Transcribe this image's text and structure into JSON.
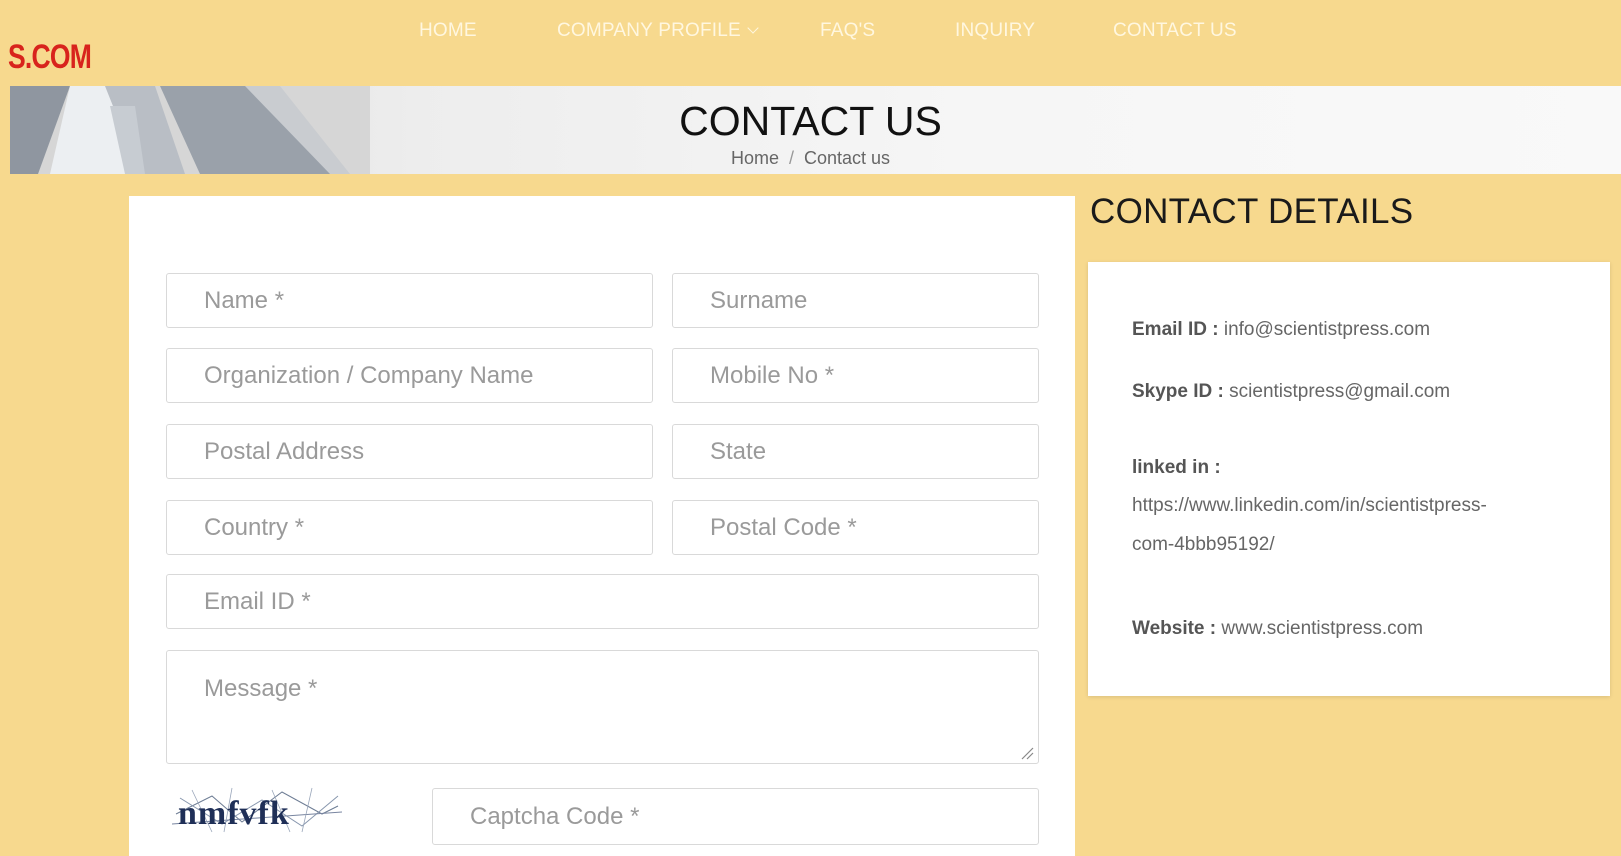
{
  "header": {
    "logo_fragment": "S.COM",
    "nav": {
      "home": "HOME",
      "company_profile": "COMPANY PROFILE",
      "faqs": "FAQ'S",
      "inquiry": "INQUIRY",
      "contact_us": "CONTACT US"
    }
  },
  "banner": {
    "title": "CONTACT US",
    "breadcrumb": {
      "home": "Home",
      "separator": "/",
      "current": "Contact us"
    }
  },
  "form": {
    "name": "Name *",
    "surname": "Surname",
    "organization": "Organization / Company Name",
    "mobile": "Mobile No *",
    "postal_address": "Postal Address",
    "state": "State",
    "country": "Country *",
    "postal_code": "Postal Code *",
    "email": "Email ID *",
    "message": "Message *",
    "captcha_image_text": "nmfvfk",
    "captcha": "Captcha Code *"
  },
  "contact_details": {
    "title": "CONTACT DETAILS",
    "email_label": "Email ID :",
    "email_value": "info@scientistpress.com",
    "skype_label": "Skype ID :",
    "skype_value": "scientistpress@gmail.com",
    "linkedin_label": "linked in :",
    "linkedin_value_line1": "https://www.linkedin.com/in/scientistpress-",
    "linkedin_value_line2": "com-4bbb95192/",
    "website_label": "Website :",
    "website_value": "www.scientistpress.com"
  },
  "colors": {
    "page_background": "#f7d98e",
    "logo_red": "#d8231c",
    "nav_text": "#fff7e0"
  }
}
